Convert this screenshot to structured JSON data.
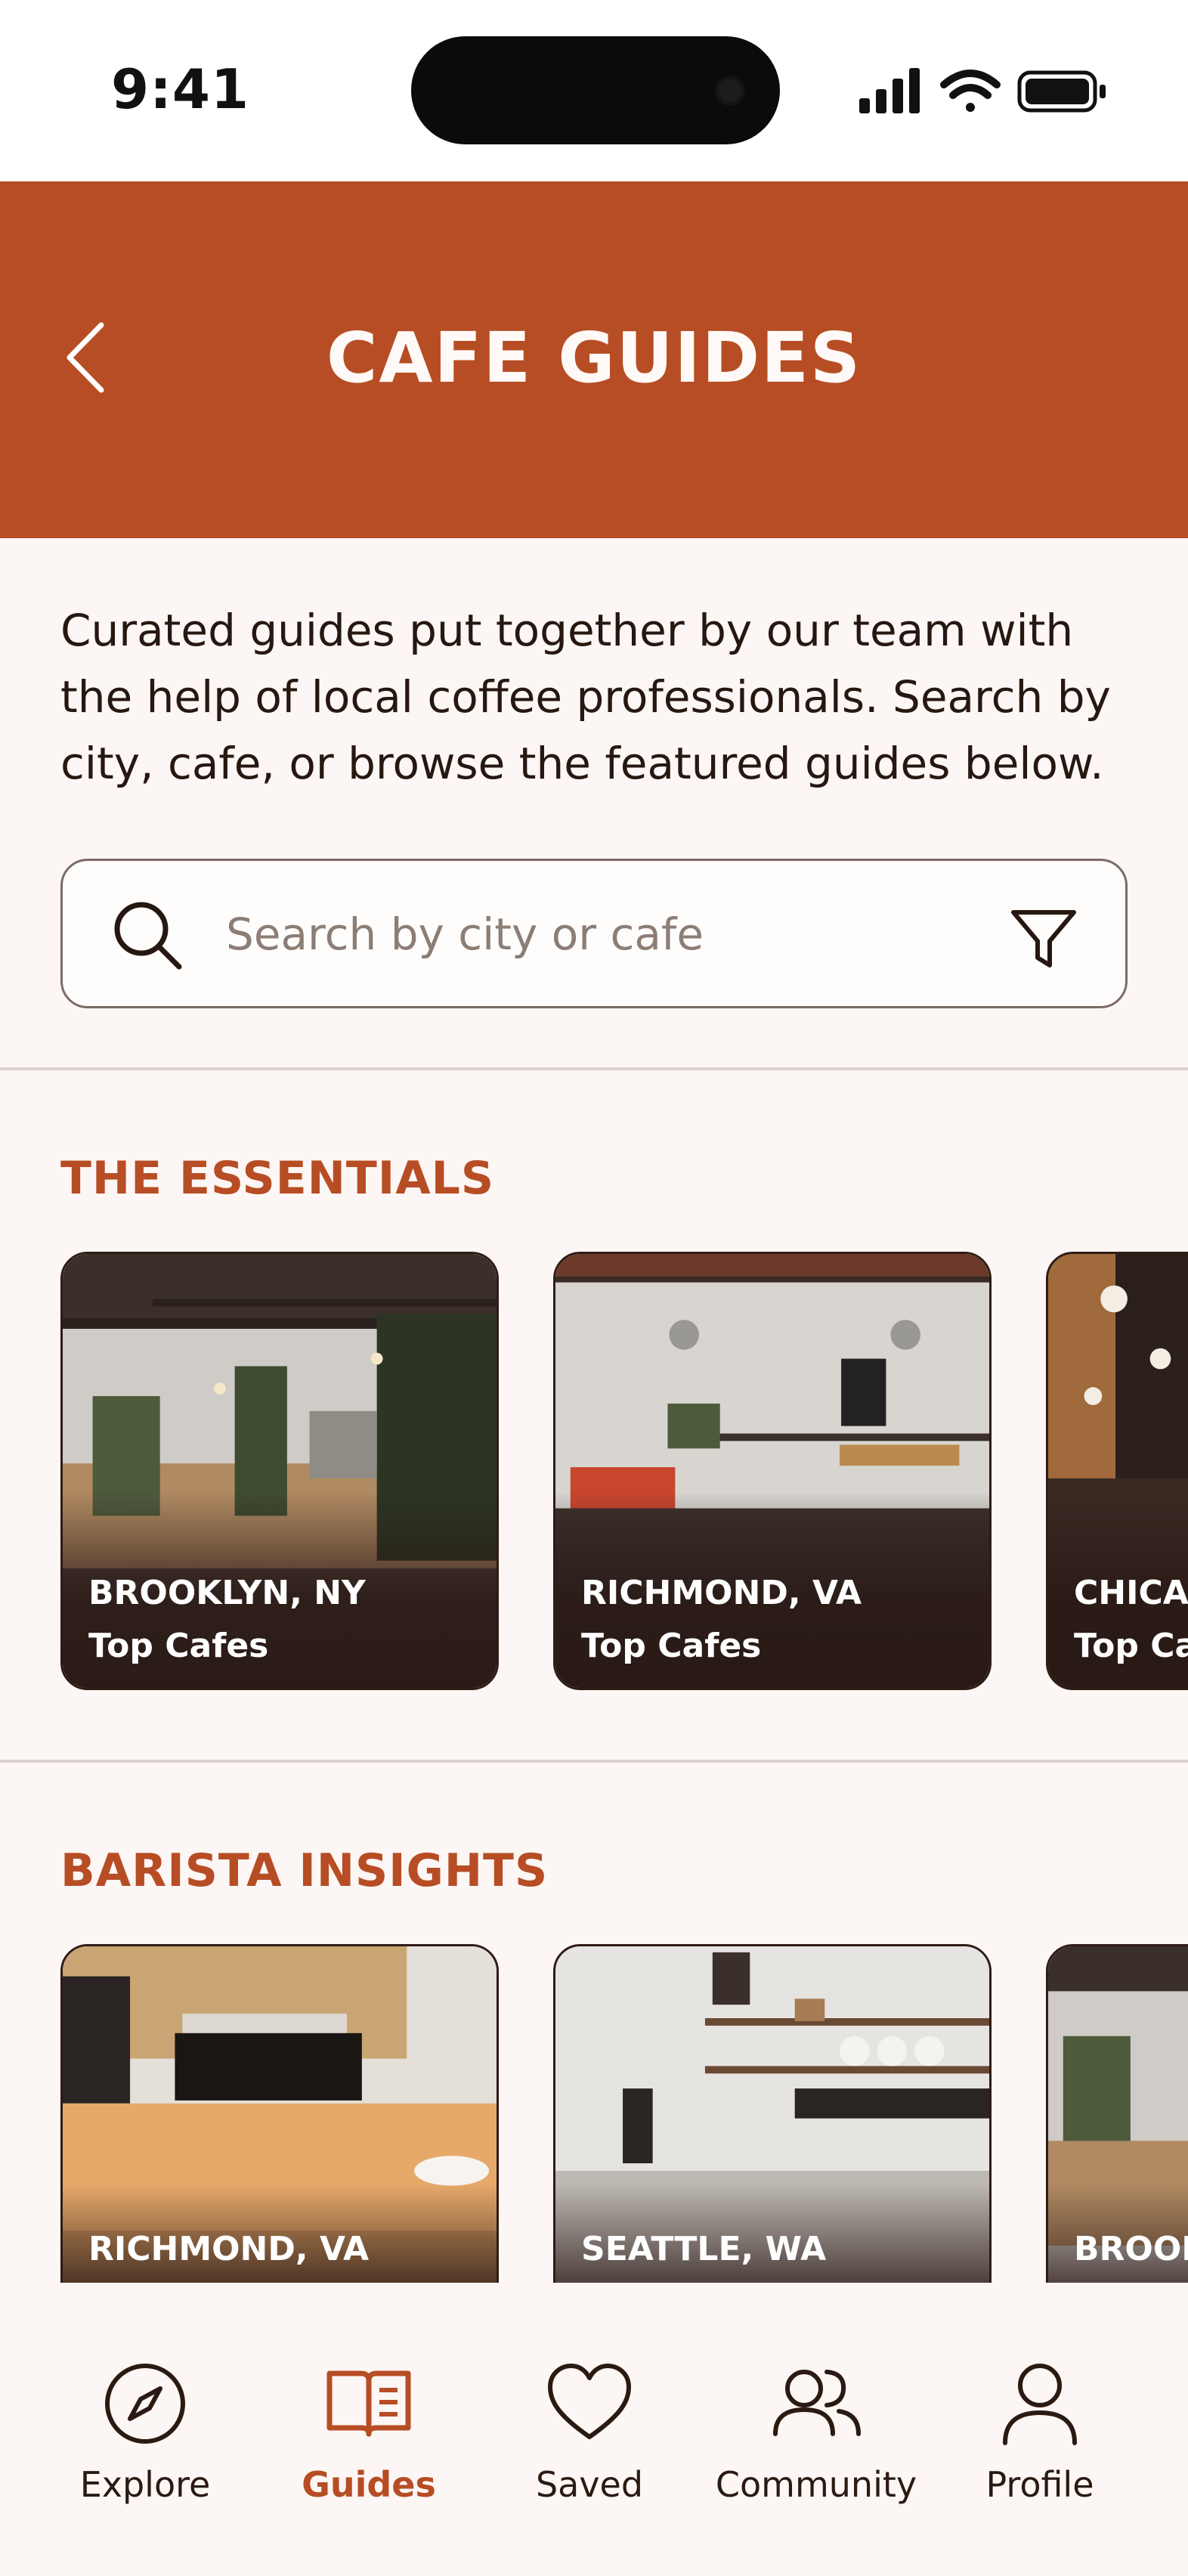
{
  "status_bar": {
    "time": "9:41"
  },
  "header": {
    "title": "CAFE GUIDES"
  },
  "intro_text": "Curated guides put together by our team with the help of local coffee professionals. Search by city, cafe, or browse the featured guides below.",
  "search": {
    "placeholder": "Search by city or cafe",
    "value": ""
  },
  "sections": {
    "essentials": {
      "title": "THE ESSENTIALS",
      "cards": [
        {
          "city": "BROOKLYN, NY",
          "subtitle": "Top Cafes"
        },
        {
          "city": "RICHMOND, VA",
          "subtitle": "Top Cafes"
        },
        {
          "city": "CHICAGO, IL",
          "subtitle": "Top Cafes"
        }
      ]
    },
    "barista": {
      "title": "BARISTA INSIGHTS",
      "cards": [
        {
          "city": "RICHMOND, VA"
        },
        {
          "city": "SEATTLE, WA"
        },
        {
          "city": "BROOKLYN, NY"
        }
      ]
    }
  },
  "tabs": [
    {
      "label": "Explore",
      "icon": "compass-icon"
    },
    {
      "label": "Guides",
      "icon": "book-icon",
      "active": true
    },
    {
      "label": "Saved",
      "icon": "heart-icon"
    },
    {
      "label": "Community",
      "icon": "people-icon"
    },
    {
      "label": "Profile",
      "icon": "user-icon"
    }
  ],
  "colors": {
    "accent": "#b74d24",
    "background": "#fcf6f4",
    "text": "#2a1a12"
  }
}
